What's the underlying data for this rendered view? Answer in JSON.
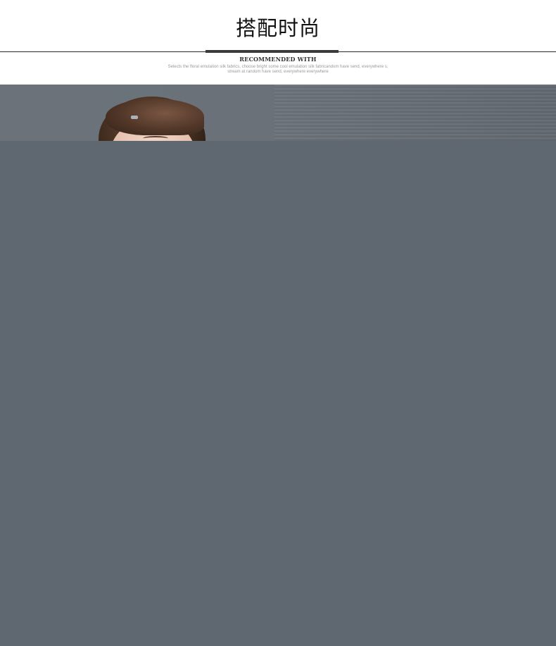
{
  "header": {
    "title": "搭配时尚",
    "subtitle": "RECOMMENDED WITH",
    "description_line1": "Selects the floral emulation silk fabrics, choose bright some cool emulation silk fabricandom have send, everywhere s,",
    "description_line2": "stream at random have send, everywhere everywhere"
  },
  "colors": {
    "background": "#ffffff",
    "title_text": "#111111",
    "rule": "#2a2a2a",
    "rule_accent": "#3a3a3a",
    "description_text": "#9a9a9a",
    "photo_background": "#6a7179",
    "lower_panel": "#5f6770"
  },
  "photo": {
    "subject": "model-portrait"
  }
}
